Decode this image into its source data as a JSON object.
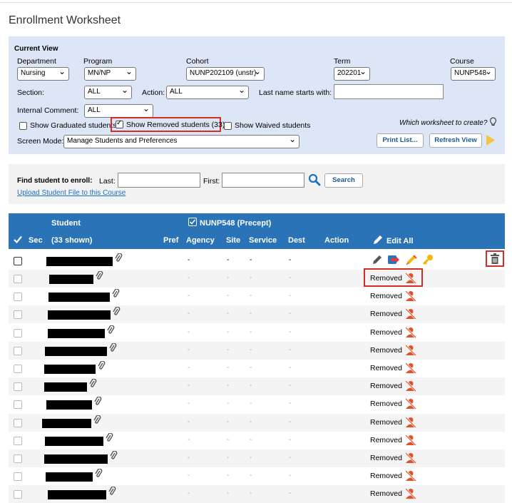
{
  "page": {
    "title": "Enrollment Worksheet"
  },
  "current_view": {
    "heading": "Current View",
    "department_label": "Department",
    "department_value": "Nursing",
    "program_label": "Program",
    "program_value": "MN/NP",
    "cohort_label": "Cohort",
    "cohort_value": "NUNP202109 (unstr)",
    "term_label": "Term",
    "term_value": "202201",
    "course_label": "Course",
    "course_value": "NUNP548",
    "section_label": "Section:",
    "section_value": "ALL",
    "action_label": "Action:",
    "action_value": "ALL",
    "lastname_label": "Last name starts with:",
    "lastname_value": "",
    "internal_comment_label": "Internal Comment:",
    "internal_comment_value": "ALL",
    "show_graduated": "Show Graduated students",
    "show_removed": "Show Removed students (33)",
    "show_waived": "Show Waived students",
    "which_worksheet": "Which worksheet to create?",
    "screen_mode_label": "Screen Mode:",
    "screen_mode_value": "Manage Students and Preferences",
    "print_list": "Print List...",
    "refresh_view": "Refresh View"
  },
  "find": {
    "label": "Find student to enroll:",
    "last_label": "Last:",
    "last_value": "",
    "first_label": "First:",
    "first_value": "",
    "search": "Search",
    "upload_link": "Upload Student File to this Course"
  },
  "table": {
    "student_header": "Student",
    "course_header": "NUNP548  (Precept)",
    "sec": "Sec",
    "shown": "(33 shown)",
    "pref": "Pref",
    "agency": "Agency",
    "site": "Site",
    "service": "Service",
    "dest": "Dest",
    "action": "Action",
    "edit_all": "Edit All",
    "dash": "-",
    "removed": "Removed"
  },
  "colors": {
    "header_bg": "#2a73b7",
    "current_view_bg": "#dde6f6",
    "highlight": "#d32d27",
    "removed_icon": "#e0522c"
  },
  "icons": [
    "checkmark-icon",
    "paperclip-icon",
    "pencil-icon",
    "transfer-icon",
    "syringe-icon",
    "key-icon",
    "trash-icon",
    "user-removed-icon",
    "search-icon",
    "lightbulb-icon",
    "play-icon"
  ]
}
